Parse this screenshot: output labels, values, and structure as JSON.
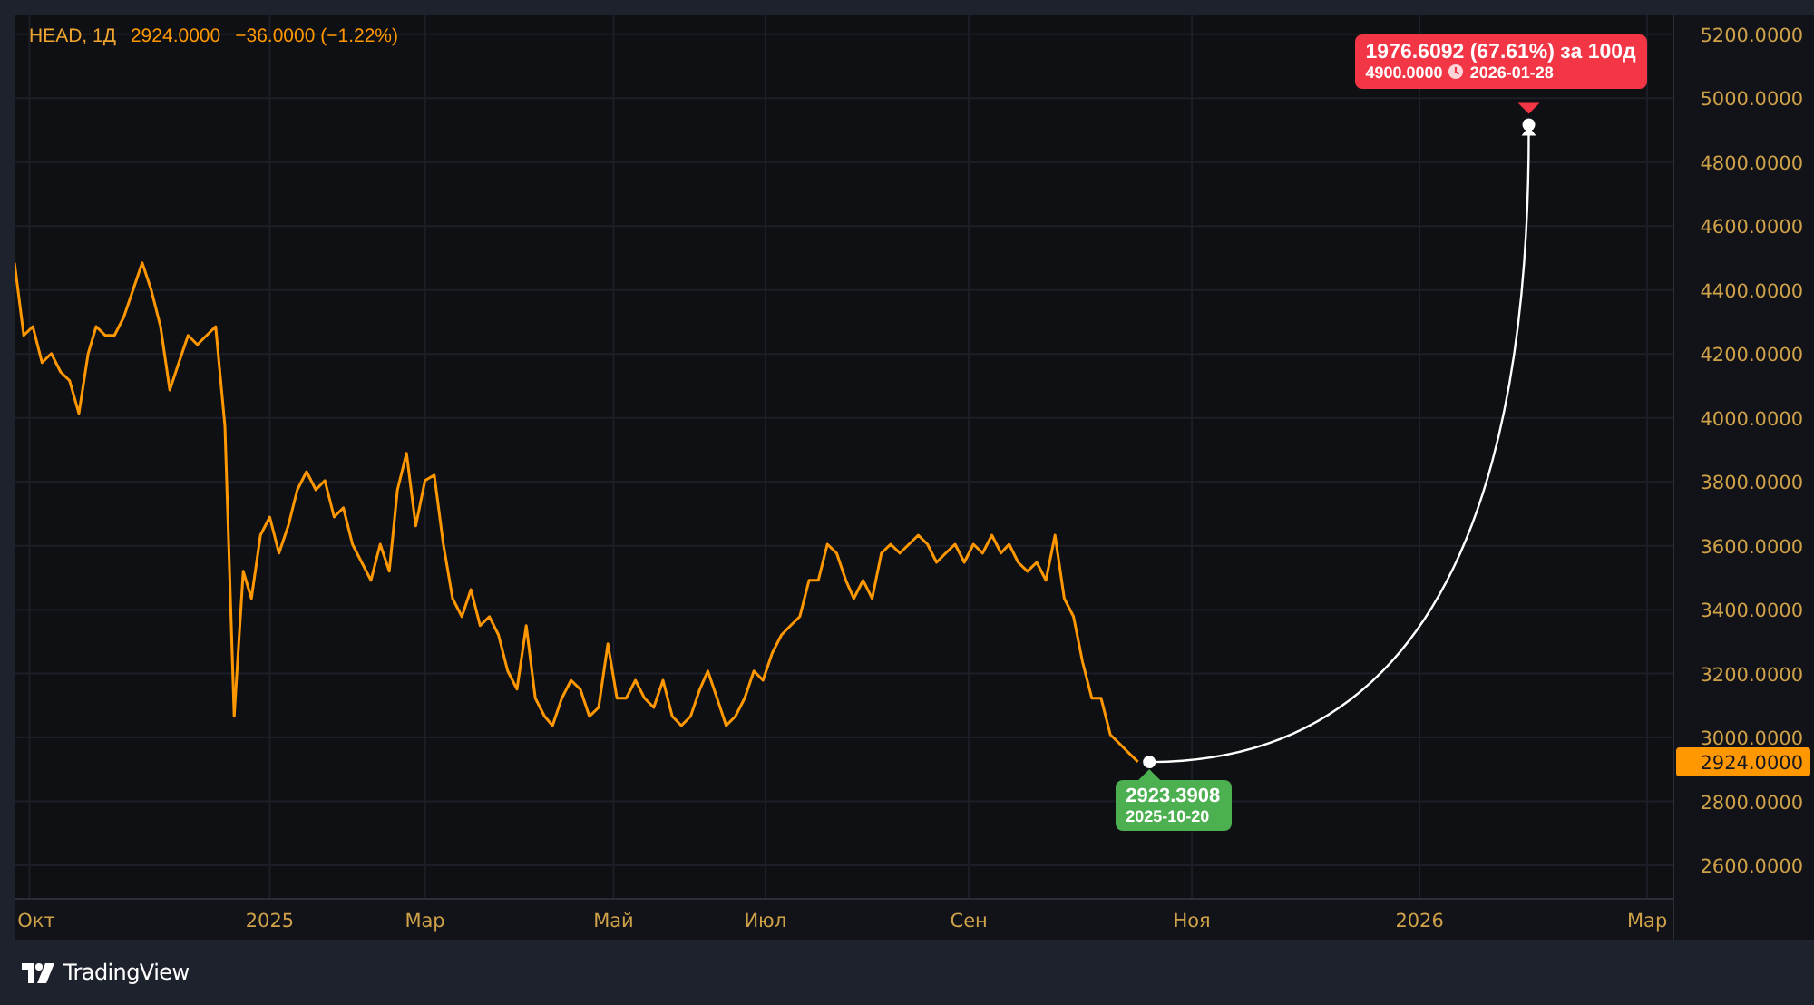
{
  "legend": {
    "symbol": "HEAD, 1Д",
    "last": "2924.0000",
    "change": "−36.0000 (−1.22%)"
  },
  "chart_data": {
    "type": "line",
    "x": [
      2024.778,
      2024.786,
      2024.794,
      2024.802,
      2024.81,
      2024.818,
      2024.826,
      2024.834,
      2024.842,
      2024.849,
      2024.857,
      2024.865,
      2024.873,
      2024.881,
      2024.889,
      2024.897,
      2024.905,
      2024.913,
      2024.921,
      2024.929,
      2024.937,
      2024.945,
      2024.953,
      2024.961,
      2024.969,
      2024.977,
      2024.984,
      2024.992,
      2025.0,
      2025.008,
      2025.016,
      2025.024,
      2025.032,
      2025.04,
      2025.048,
      2025.056,
      2025.064,
      2025.072,
      2025.08,
      2025.088,
      2025.096,
      2025.104,
      2025.111,
      2025.119,
      2025.127,
      2025.135,
      2025.143,
      2025.151,
      2025.159,
      2025.167,
      2025.175,
      2025.183,
      2025.191,
      2025.199,
      2025.207,
      2025.215,
      2025.223,
      2025.231,
      2025.239,
      2025.246,
      2025.254,
      2025.262,
      2025.27,
      2025.278,
      2025.286,
      2025.294,
      2025.302,
      2025.31,
      2025.318,
      2025.326,
      2025.334,
      2025.342,
      2025.35,
      2025.358,
      2025.366,
      2025.374,
      2025.381,
      2025.389,
      2025.397,
      2025.405,
      2025.413,
      2025.421,
      2025.429,
      2025.437,
      2025.445,
      2025.453,
      2025.461,
      2025.469,
      2025.477,
      2025.485,
      2025.493,
      2025.501,
      2025.508,
      2025.516,
      2025.524,
      2025.532,
      2025.54,
      2025.548,
      2025.556,
      2025.564,
      2025.572,
      2025.58,
      2025.588,
      2025.596,
      2025.604,
      2025.612,
      2025.62,
      2025.628,
      2025.636,
      2025.643,
      2025.651,
      2025.659,
      2025.667,
      2025.675,
      2025.683,
      2025.691,
      2025.699,
      2025.707,
      2025.715,
      2025.723,
      2025.731,
      2025.739,
      2025.747,
      2025.755
    ],
    "series": [
      {
        "color": "#ff9800",
        "values": [
          4485,
          4258,
          4286,
          4173,
          4201,
          4144,
          4116,
          4014,
          4201,
          4286,
          4258,
          4258,
          4315,
          4400,
          4485,
          4400,
          4286,
          4087,
          4173,
          4258,
          4229,
          4258,
          4286,
          3974,
          3066,
          3520,
          3435,
          3633,
          3690,
          3577,
          3662,
          3775,
          3832,
          3775,
          3804,
          3690,
          3719,
          3605,
          3548,
          3492,
          3605,
          3520,
          3775,
          3889,
          3662,
          3804,
          3821,
          3605,
          3435,
          3378,
          3463,
          3350,
          3378,
          3321,
          3208,
          3151,
          3350,
          3123,
          3066,
          3037,
          3123,
          3179,
          3151,
          3066,
          3094,
          3293,
          3123,
          3123,
          3179,
          3123,
          3094,
          3179,
          3066,
          3037,
          3066,
          3151,
          3208,
          3123,
          3037,
          3066,
          3123,
          3208,
          3179,
          3264,
          3321,
          3350,
          3378,
          3492,
          3492,
          3605,
          3577,
          3492,
          3435,
          3492,
          3435,
          3577,
          3605,
          3577,
          3605,
          3633,
          3605,
          3548,
          3577,
          3605,
          3548,
          3605,
          3577,
          3633,
          3577,
          3605,
          3548,
          3520,
          3548,
          3492,
          3633,
          3435,
          3378,
          3236,
          3123,
          3123,
          3009,
          2981,
          2952,
          2924
        ]
      }
    ],
    "xlim": [
      2024.778,
      2026.22
    ],
    "grid": true,
    "ylim": [
      2498,
      5262
    ],
    "xticks": [
      {
        "value": 2024.791,
        "label": "Окт"
      },
      2025,
      {
        "value": 2025.135,
        "label": "Мар"
      },
      {
        "value": 2025.299,
        "label": "Май"
      },
      {
        "value": 2025.431,
        "label": "Июл"
      },
      {
        "value": 2025.608,
        "label": "Сен"
      },
      {
        "value": 2025.802,
        "label": "Ноя"
      },
      2026,
      {
        "value": 2026.198,
        "label": "Мар"
      }
    ],
    "yticks": [
      {
        "value": 2600,
        "label": "2600.0000"
      },
      {
        "value": 2800,
        "label": "2800.0000"
      },
      {
        "value": 3000,
        "label": "3000.0000"
      },
      {
        "value": 3200,
        "label": "3200.0000"
      },
      {
        "value": 3400,
        "label": "3400.0000"
      },
      {
        "value": 3600,
        "label": "3600.0000"
      },
      {
        "value": 3800,
        "label": "3800.0000"
      },
      {
        "value": 4000,
        "label": "4000.0000"
      },
      {
        "value": 4200,
        "label": "4200.0000"
      },
      {
        "value": 4400,
        "label": "4400.0000"
      },
      {
        "value": 4600,
        "label": "4600.0000"
      },
      {
        "value": 4800,
        "label": "4800.0000"
      },
      {
        "value": 5000,
        "label": "5000.0000"
      },
      {
        "value": 5200,
        "label": "5200.0000"
      }
    ]
  },
  "measure": {
    "start": {
      "price": "2923.3908",
      "date": "2025-10-20"
    },
    "end": {
      "change": "1976.6092 (67.61%) за 100д",
      "price": "4900.0000",
      "date": "2026-01-28"
    }
  },
  "price_scale": {
    "last_price": "2924.0000"
  },
  "footer": {
    "brand": "TradingView"
  }
}
